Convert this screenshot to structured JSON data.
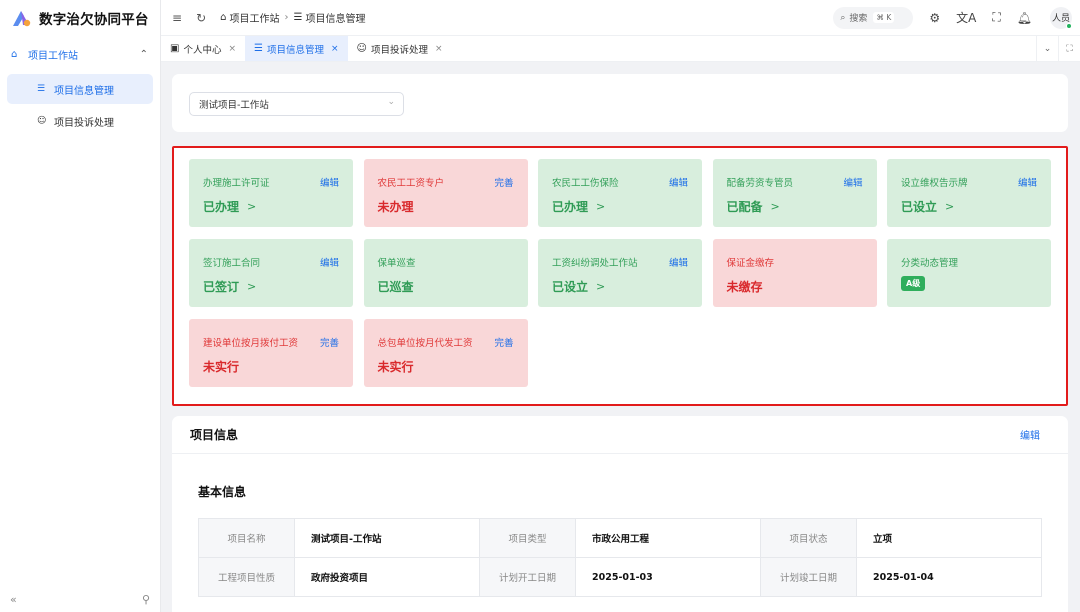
{
  "app": {
    "name": "数字治欠协同平台"
  },
  "sidebar": {
    "group": {
      "label": "项目工作站"
    },
    "items": [
      {
        "label": "项目信息管理"
      },
      {
        "label": "项目投诉处理"
      }
    ],
    "collapse_glyph": "«"
  },
  "header": {
    "breadcrumb": [
      {
        "label": "项目工作站"
      },
      {
        "label": "项目信息管理"
      }
    ],
    "search": {
      "label": "搜索",
      "shortcut": "⌘ K"
    },
    "avatar_text": "人员"
  },
  "tabs": [
    {
      "label": "个人中心"
    },
    {
      "label": "项目信息管理"
    },
    {
      "label": "项目投诉处理"
    }
  ],
  "project_select": {
    "value": "测试项目-工作站"
  },
  "status_tiles": [
    {
      "name": "办理施工许可证",
      "action": "编辑",
      "status": "已办理",
      "state": "ok"
    },
    {
      "name": "农民工工资专户",
      "action": "完善",
      "status": "未办理",
      "state": "bad"
    },
    {
      "name": "农民工工伤保险",
      "action": "编辑",
      "status": "已办理",
      "state": "ok"
    },
    {
      "name": "配备劳资专管员",
      "action": "编辑",
      "status": "已配备",
      "state": "ok"
    },
    {
      "name": "设立维权告示牌",
      "action": "编辑",
      "status": "已设立",
      "state": "ok"
    },
    {
      "name": "签订施工合同",
      "action": "编辑",
      "status": "已签订",
      "state": "ok"
    },
    {
      "name": "保单巡查",
      "action": "",
      "status": "已巡查",
      "state": "ok"
    },
    {
      "name": "工资纠纷调处工作站",
      "action": "编辑",
      "status": "已设立",
      "state": "ok"
    },
    {
      "name": "保证金缴存",
      "action": "",
      "status": "未缴存",
      "state": "bad"
    },
    {
      "name": "分类动态管理",
      "action": "",
      "status": "A级",
      "state": "ok"
    },
    {
      "name": "建设单位按月拨付工资",
      "action": "完善",
      "status": "未实行",
      "state": "bad"
    },
    {
      "name": "总包单位按月代发工资",
      "action": "完善",
      "status": "未实行",
      "state": "bad"
    }
  ],
  "project_info": {
    "title": "项目信息",
    "edit_label": "编辑",
    "section_title": "基本信息",
    "rows": [
      [
        {
          "k": "项目名称",
          "v": "测试项目-工作站"
        },
        {
          "k": "项目类型",
          "v": "市政公用工程"
        },
        {
          "k": "项目状态",
          "v": "立项"
        }
      ],
      [
        {
          "k": "工程项目性质",
          "v": "政府投资项目"
        },
        {
          "k": "计划开工日期",
          "v": "2025-01-03"
        },
        {
          "k": "计划竣工日期",
          "v": "2025-01-04"
        }
      ]
    ]
  },
  "colors": {
    "accent": "#1d6ee8",
    "ok_bg": "#d8eedd",
    "bad_bg": "#f9d7d8",
    "highlight_border": "#e21b1b"
  }
}
